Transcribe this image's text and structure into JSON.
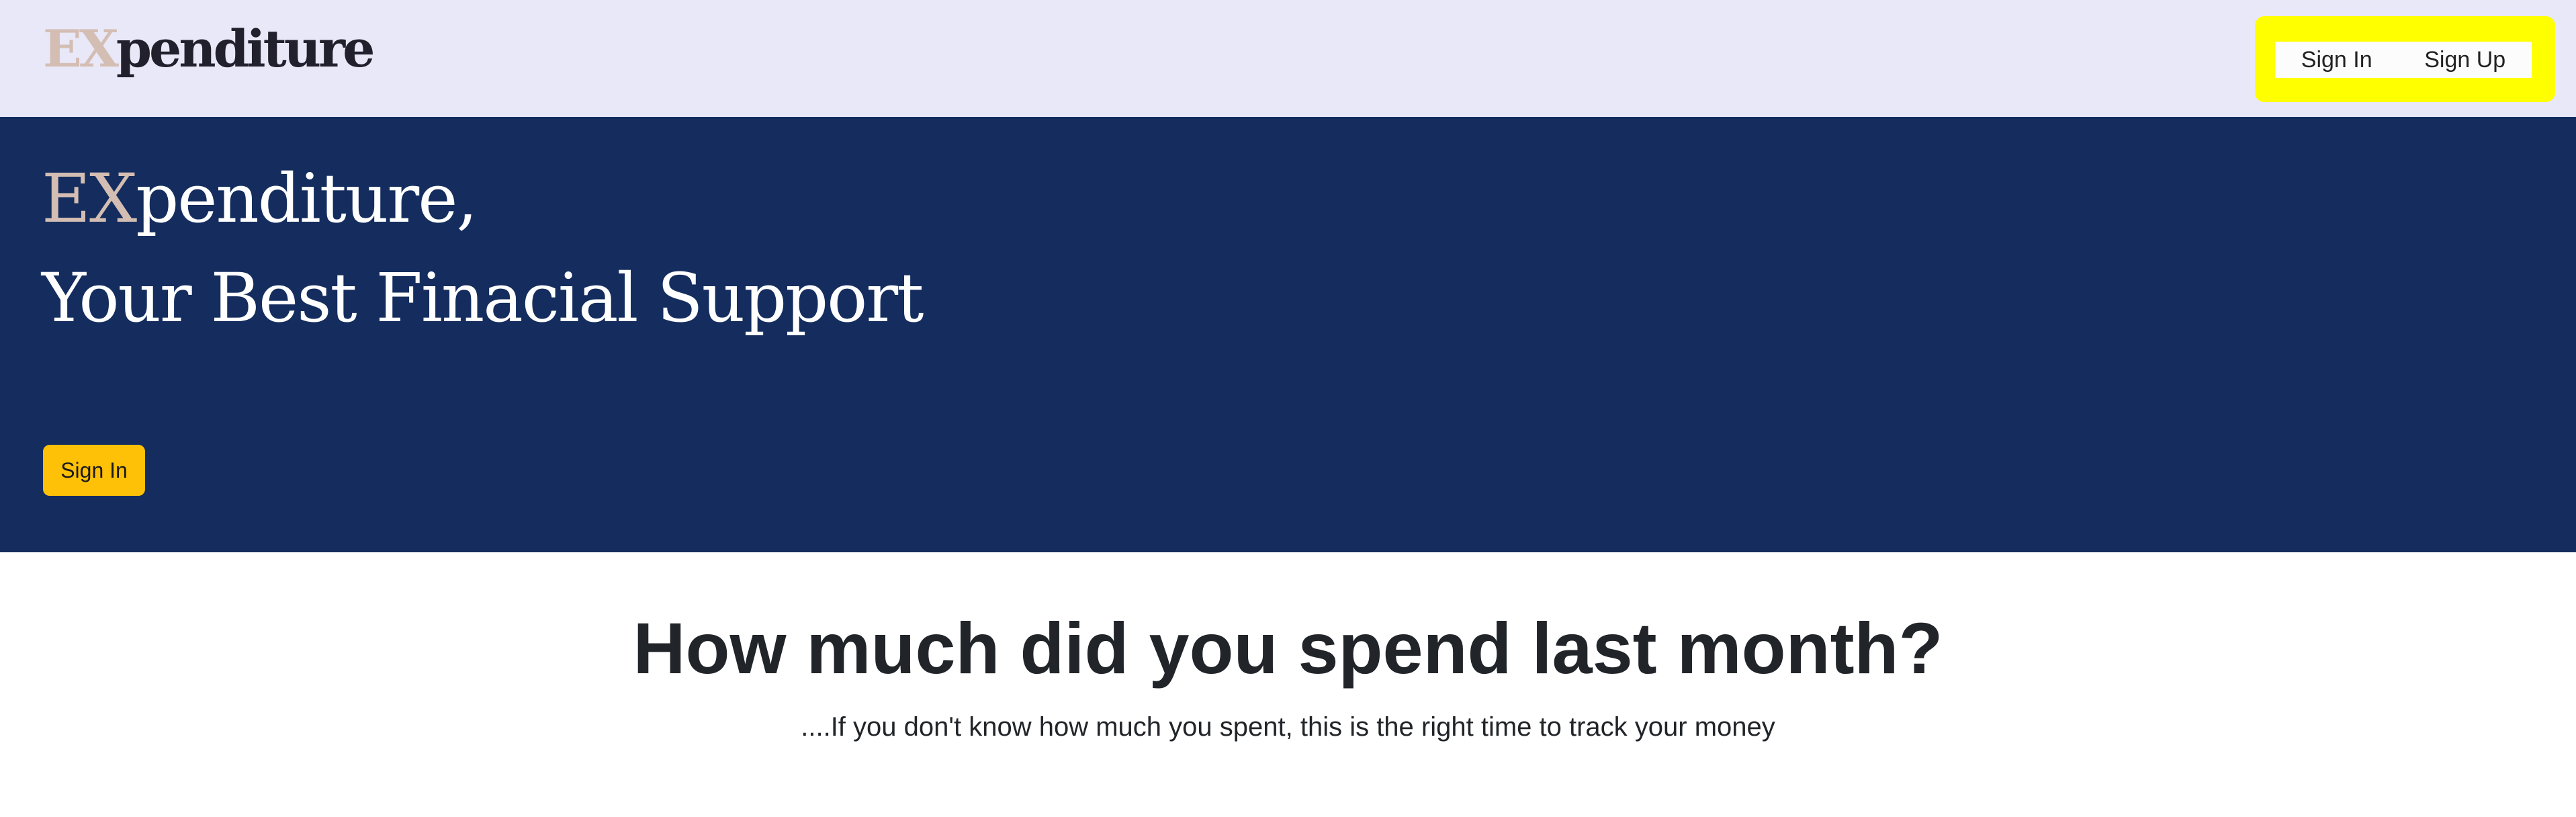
{
  "navbar": {
    "logo_prefix": "EX",
    "logo_suffix": "penditure",
    "sign_in_label": "Sign In",
    "sign_up_label": "Sign Up"
  },
  "hero": {
    "line1_prefix": "EX",
    "line1_suffix": "penditure,",
    "line2": "Your Best Finacial Support",
    "sign_in_label": "Sign In"
  },
  "content": {
    "headline": "How much did you spend last month?",
    "subline": "....If you don't know how much you spent, this is the right time to track your money"
  },
  "colors": {
    "navbar_bg": "#e9e8f8",
    "hero_bg": "#142d5e",
    "accent_button": "#ffc107",
    "highlight": "#ffff00",
    "logo_ex": "#d4bdb3"
  }
}
